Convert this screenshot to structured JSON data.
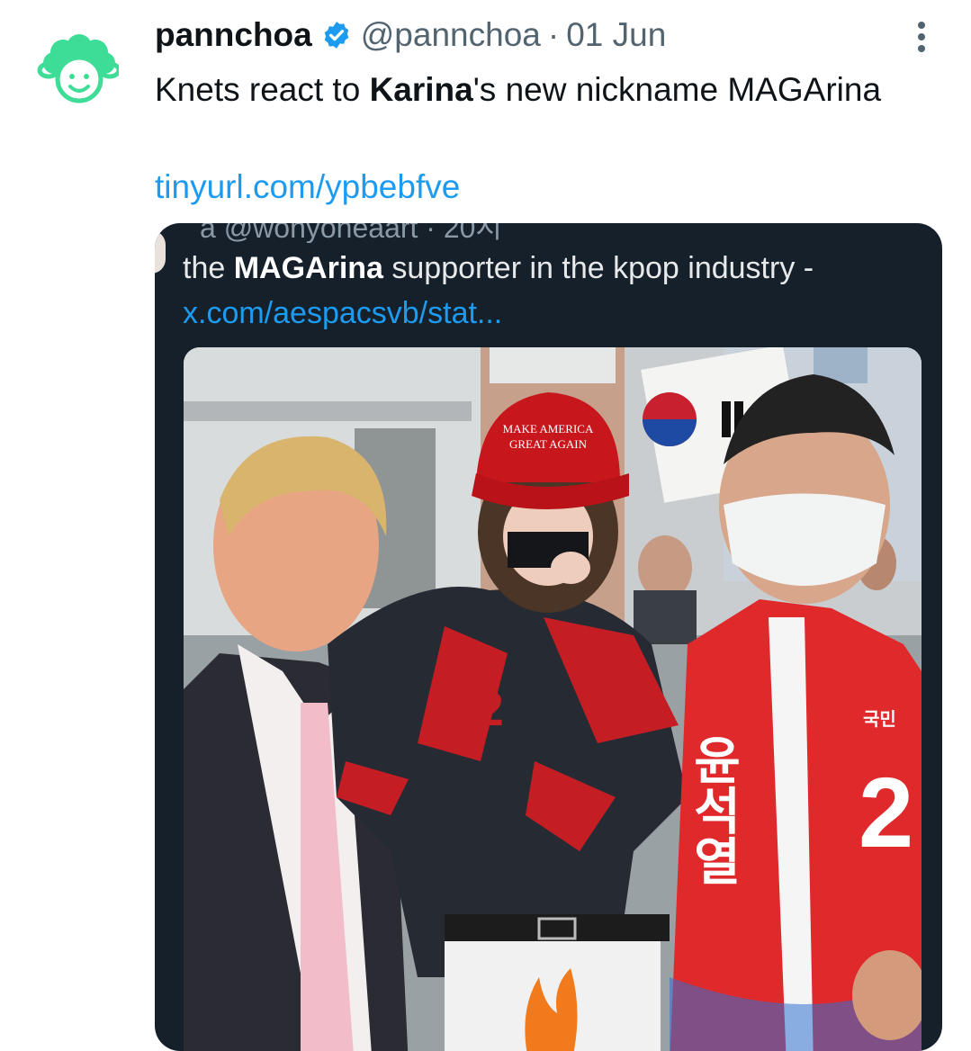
{
  "tweet": {
    "author_name": "pannchoa",
    "author_handle": "@pannchoa",
    "separator": "·",
    "date": "01 Jun",
    "text_part1": "Knets react to ",
    "text_bold": "Karina",
    "text_part2": "'s new nickname MAGArina",
    "link": "tinyurl.com/ypbebfve",
    "icons": {
      "avatar": "sheep-mascot-avatar",
      "verified": "verified-badge-icon",
      "more": "more-options-icon"
    },
    "colors": {
      "link": "#1d9bf0",
      "verified": "#1d9bf0",
      "avatar": "#3ddc97",
      "secondary_text": "#536471"
    }
  },
  "quote": {
    "clipped_header": "a @wonyoneaart · 20시",
    "text_before": "the ",
    "text_bold": "MAGArina",
    "text_after": " supporter in the kpop industry -",
    "link": "x.com/aespacsvb/stat...",
    "media": {
      "hat_line1": "MAKE AMERICA",
      "hat_line2": "GREAT AGAIN",
      "jacket_text": "2",
      "sash_text": "윤석열",
      "badge_text": "국민",
      "badge_number": "2"
    },
    "colors": {
      "card_bg": "#15202b",
      "text": "#e7e9ea",
      "link": "#1d9bf0"
    }
  }
}
